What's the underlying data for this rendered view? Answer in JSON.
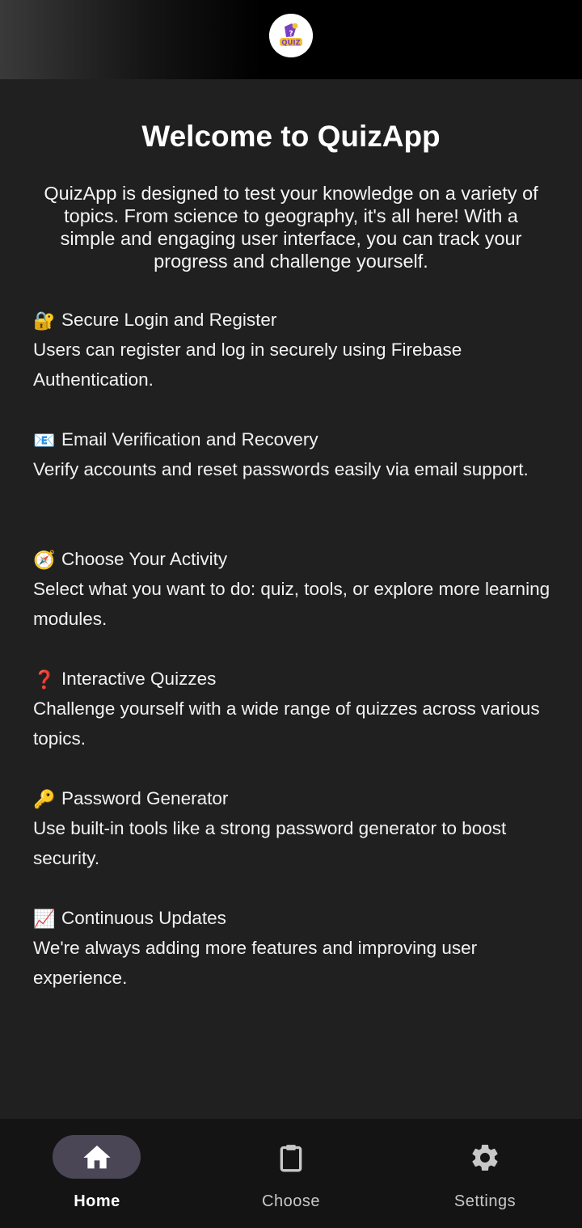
{
  "header": {
    "logo_icon": "quiz-logo-icon",
    "logo_text": "QUIZ"
  },
  "main": {
    "title": "Welcome to QuizApp",
    "intro": "QuizApp is designed to test your knowledge on a variety of topics. From science to geography, it's all here! With a simple and engaging user interface, you can track your progress and challenge yourself.",
    "features": [
      {
        "icon": "🔐",
        "icon_name": "lock-with-key-icon",
        "title": "Secure Login and Register",
        "description": "Users can register and log in securely using Firebase Authentication."
      },
      {
        "icon": "📧",
        "icon_name": "email-icon",
        "title": "Email Verification and Recovery",
        "description": "Verify accounts and reset passwords easily via email support."
      },
      {
        "icon": "🧭",
        "icon_name": "compass-icon",
        "title": "Choose Your Activity",
        "description": "Select what you want to do: quiz, tools, or explore more learning modules."
      },
      {
        "icon": "❓",
        "icon_name": "question-mark-icon",
        "title": "Interactive Quizzes",
        "description": "Challenge yourself with a wide range of quizzes across various topics."
      },
      {
        "icon": "🔑",
        "icon_name": "key-icon",
        "title": "Password Generator",
        "description": "Use built-in tools like a strong password generator to boost security."
      },
      {
        "icon": "📈",
        "icon_name": "chart-increasing-icon",
        "title": "Continuous Updates",
        "description": "We're always adding more features and improving user experience."
      }
    ]
  },
  "bottom_nav": {
    "items": [
      {
        "label": "Home",
        "icon": "home-icon",
        "active": true
      },
      {
        "label": "Choose",
        "icon": "clipboard-icon",
        "active": false
      },
      {
        "label": "Settings",
        "icon": "gear-icon",
        "active": false
      }
    ]
  },
  "colors": {
    "background": "#202020",
    "topbar": "#000000",
    "nav_background": "#141414",
    "active_pill": "#4a4656",
    "text": "#f2f2f2"
  }
}
